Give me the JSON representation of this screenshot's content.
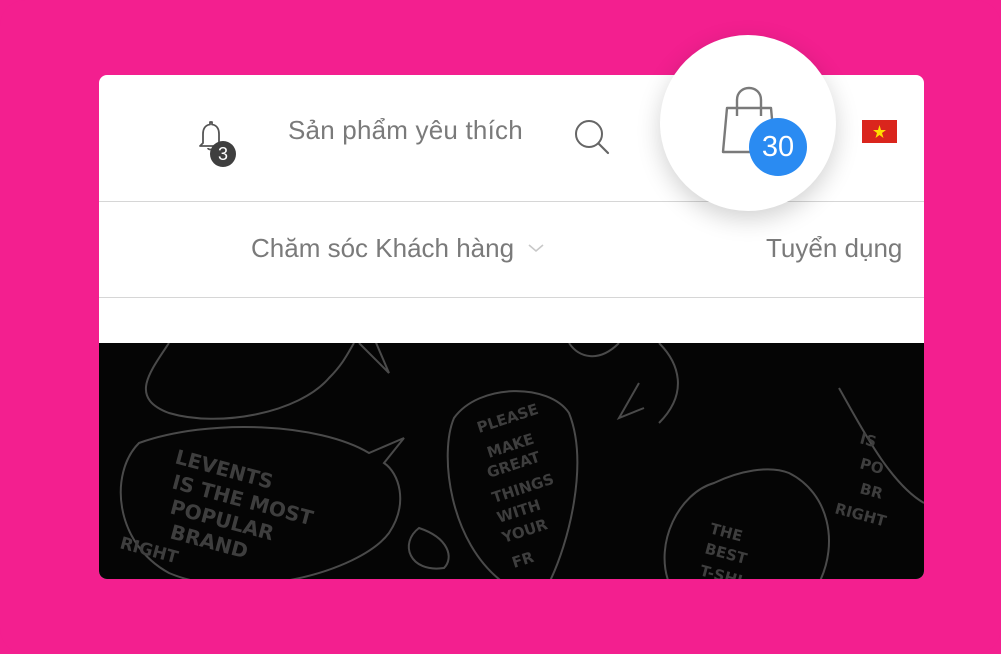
{
  "header": {
    "notifications": {
      "icon": "bell-icon",
      "count": "3"
    },
    "favorites_label": "Sản phẩm yêu thích",
    "search": {
      "icon": "search-icon"
    },
    "cart": {
      "icon": "shopping-bag-icon",
      "count": "30",
      "badge_color": "#2a8bf2"
    },
    "language_flag": {
      "icon": "vietnam-flag-icon"
    }
  },
  "nav": {
    "items": [
      {
        "label": "Chăm sóc Khách hàng",
        "has_dropdown": true,
        "icon": "chevron-down-icon"
      },
      {
        "label": "Tuyển dụng"
      }
    ]
  },
  "banner": {
    "texts": [
      "LEVENTS IS THE MOST POPULAR BRAND RIGHT",
      "PLEASE MAKE GREAT THINGS WITH YOUR FR IE",
      "THE BEST T-SHI",
      "IS PO BR RIGHT"
    ]
  },
  "colors": {
    "background": "#f31f8f",
    "accent": "#2a8bf2",
    "text": "#7a7a7a"
  }
}
